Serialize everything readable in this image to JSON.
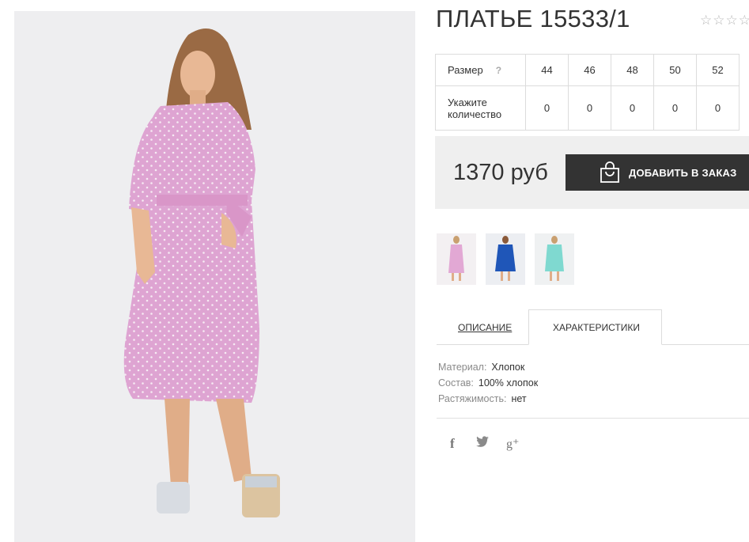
{
  "product": {
    "title": "ПЛАТЬЕ 15533/1",
    "rating": "☆☆☆☆"
  },
  "sizes": {
    "label": "Размер",
    "help": "?",
    "values": [
      "44",
      "46",
      "48",
      "50",
      "52"
    ],
    "qty_label_line1": "Укажите",
    "qty_label_line2": "количество",
    "quantities": [
      "0",
      "0",
      "0",
      "0",
      "0"
    ]
  },
  "order": {
    "price": "1370 руб",
    "button_label": "ДОБАВИТЬ В ЗАКАЗ"
  },
  "thumbnails": [
    {
      "color": "pink",
      "dress": "#e2a8d4"
    },
    {
      "color": "blue",
      "dress": "#1f56b8"
    },
    {
      "color": "mint",
      "dress": "#7fd9d0"
    }
  ],
  "tabs": {
    "description": "ОПИСАНИЕ",
    "characteristics": "ХАРАКТЕРИСТИКИ"
  },
  "specs": [
    {
      "key": "Материал:",
      "value": "Хлопок"
    },
    {
      "key": "Состав:",
      "value": "100% хлопок"
    },
    {
      "key": "Растяжимость:",
      "value": "нет"
    }
  ],
  "social": {
    "facebook": "f",
    "twitter": "🐦",
    "googleplus": "g⁺"
  },
  "colors": {
    "button_bg": "#333333",
    "price_box_bg": "#efefef",
    "dress_pink": "#e2a8d4"
  }
}
